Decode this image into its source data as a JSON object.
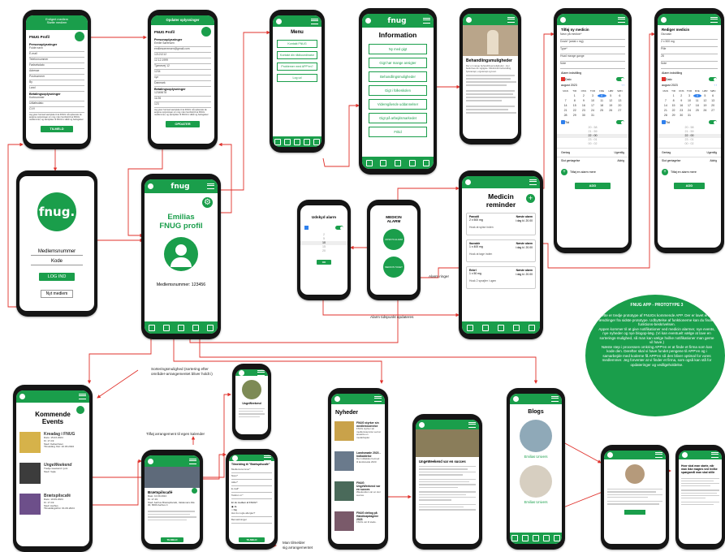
{
  "tilmeld_phone": {
    "header": [
      "Erdigert medlem",
      "Støtte medlem"
    ],
    "title": "FNUG Profil",
    "personal_section": "Personoplysninger",
    "fields": [
      "Fulde navn",
      "E-mail",
      "Telefonnummer",
      "Fødselsdato",
      "Adresse",
      "Postnummer",
      "By",
      "Land"
    ],
    "payment_section": "Betalingsoplysninger",
    "payment_fields": [
      "Kortnummer",
      "Udløbsdato",
      "CVV"
    ],
    "consent": "Jeg giver hermed samtykke til at FNUG må opbevare de angivne oplysninger om mig i den henhold til at FNUG medlemmer, og samtykker til FNUG's vilkår og betingelser",
    "button": "TILMELD"
  },
  "opdater_phone": {
    "header": "Opdater oplysninger",
    "title": "FNUG Profil",
    "personal_section": "Personoplysninger",
    "values": [
      "Emilie Sørensen",
      "emiliesoerensen@gmail.com",
      "12121212",
      "12.12.1999",
      "Tjørnevej 12",
      "1234",
      "xyz",
      "Danmark"
    ],
    "payment_section": "Betalingsoplysninger",
    "payment_values": [
      "12345678",
      "11/26",
      "123"
    ],
    "consent": "Jeg giver hermed samtykke til at FNUG må opbevare de angivne oplysninger om mig i den henhold til at FNUG medlemmer, og samtykker til FNUG's vilkår og betingelser",
    "button": "OPDATER"
  },
  "menu_phone": {
    "title": "Menu",
    "items": [
      "Kontakt FNUG",
      "Kontakt din rådkoordinator",
      "Problemer med APP'en?",
      "Log ud"
    ]
  },
  "info_phone": {
    "logo": "fnug",
    "title": "Information",
    "items": [
      "Ny med gigt",
      "Gigt hør mange ansigter",
      "Behandlingsmuligheder",
      "Gigt i folkeskolen",
      "Videregående uddannelser",
      "Gigt på arbejdsmarkedet",
      "Fritid"
    ]
  },
  "behandling_phone": {
    "title": "Behandlingsmuligheder",
    "body": "Der er mange behandlingsmuligheder - Her beskrives de vigtigste. Medicinsk behandling, fysioterapi, ergoterapi og kost."
  },
  "tilfoj_medicin_phone": {
    "title": "Tilføj ny medicin",
    "fields": [
      "Navn på medicin*",
      "Dosis* (antal x mg)",
      "Type*",
      "Hvad mange gange",
      "Note"
    ],
    "reminder_label": "Alarm indstilling",
    "start_label": "Dato",
    "month": "august 2023",
    "weekdays": [
      "MAN",
      "TIR",
      "ONS",
      "TOR",
      "FRE",
      "LØR",
      "SØN"
    ],
    "days": [
      "",
      "1",
      "2",
      "3",
      "4",
      "5",
      "6",
      "7",
      "8",
      "9",
      "10",
      "11",
      "12",
      "13",
      "14",
      "15",
      "16",
      "17",
      "18",
      "19",
      "20",
      "21",
      "22",
      "23",
      "24",
      "25",
      "26",
      "27",
      "28",
      "29",
      "30",
      "31"
    ],
    "selected_day": "4",
    "time_label": "Tid",
    "time_values": [
      "20 : 58",
      "21 : 59",
      "22 : 00",
      "23 : 01",
      "00 : 02"
    ],
    "repeat_label": "Gentag",
    "repeat_value": "Ugentlig",
    "ring_label": "Slut gentagelse",
    "ring_value": "Aldrig",
    "add_alarm": "Tilføj en alarm mere",
    "button": "ADD"
  },
  "rediger_medicin_phone": {
    "title": "Rediger medicin",
    "fields": [
      "Gluvasin",
      "2 x 500 mg",
      "Pille",
      "28",
      "Note"
    ],
    "reminder_label": "Alarm indstilling",
    "start_label": "Dato",
    "month": "august 2023",
    "weekdays": [
      "MAN",
      "TIR",
      "ONS",
      "TOR",
      "FRE",
      "LØR",
      "SØN"
    ],
    "days": [
      "",
      "1",
      "2",
      "3",
      "4",
      "5",
      "6",
      "7",
      "8",
      "9",
      "10",
      "11",
      "12",
      "13",
      "14",
      "15",
      "16",
      "17",
      "18",
      "19",
      "20",
      "21",
      "22",
      "23",
      "24",
      "25",
      "26",
      "27",
      "28",
      "29",
      "30",
      "31"
    ],
    "selected_day": "4",
    "time_label": "Tid",
    "time_values": [
      "20 : 58",
      "21 : 59",
      "22 : 00",
      "23 : 01",
      "00 : 02"
    ],
    "repeat_label": "Gentag",
    "repeat_value": "Ugentlig",
    "ring_label": "Slut gentagelse",
    "ring_value": "Aldrig",
    "add_alarm": "Tilføj en alarm mere",
    "button": "ADD"
  },
  "login_phone": {
    "logo": "fnug.",
    "member_field": "Medlemsnummer",
    "code_field": "Kode",
    "login_button": "LOG IND",
    "new_member": "Nyt medlem"
  },
  "profile_phone": {
    "logo": "fnug",
    "title_line1": "Emilias",
    "title_line2": "FNUG profil",
    "member_number": "Medlemsnummer: 123456"
  },
  "medicin_phone": {
    "title_line1": "Medicin",
    "title_line2": "reminder",
    "cards": [
      {
        "name": "Panodil",
        "dose": "2 x 500 mg",
        "note": "Husk at spise inden",
        "next_label": "Næste alarm",
        "next": "i dag kl. 20.00"
      },
      {
        "name": "Ibuvabir",
        "dose": "1 x 400 mg",
        "note": "Husk at tage inden",
        "next_label": "Næste alarm",
        "next": "i dag kl. 20.00"
      },
      {
        "name": "Enbrl",
        "dose": "1 x 50 mg",
        "note": "Husk 2 sprøjter i ugen",
        "next_label": "Næste alarm",
        "next": "i dag kl. 20.00"
      }
    ]
  },
  "udskyd_phone": {
    "title": "Udskyd alarm",
    "time_values": [
      "2",
      "5",
      "10",
      "15",
      "20"
    ],
    "button": "OK"
  },
  "alarm_phone": {
    "title_line1": "MEDICIN",
    "title_line2": "ALARM",
    "snooze": "UDSKYD ALARM",
    "taken": "MEDICIN TAGET"
  },
  "events_phone": {
    "title_line1": "Kommende",
    "title_line2": "Events",
    "events": [
      {
        "title": "Kreadag i FNUG",
        "lines": [
          "Dato: 15.03.2024",
          "Kl. 17-19",
          "Sted: København",
          "Tilmelding frist: 10.03.2024"
        ]
      },
      {
        "title": "UngeWeekend",
        "lines": [
          "Tredje weekend i juni",
          "Sted: Vejle"
        ]
      },
      {
        "title": "Brætspilscafé",
        "lines": [
          "Dato: 10.09.2024",
          "Kl. 17-19",
          "Sted: Aarhus",
          "Tilmeldingsfrist: 01.09.2024"
        ]
      }
    ]
  },
  "cafe_phone": {
    "title": "Brætspilscafé",
    "lines": [
      "Dato: 10.09.2024",
      "Kl. 17-19",
      "Sted: Aarhus Brætspilscafé, Valdemars Allé 30, 8000 Aarhus C"
    ],
    "button": "TILMELD"
  },
  "ungeweekend_phone": {
    "title": "UngeWeekend"
  },
  "form_phone": {
    "title": "Tilmelding til \"Brætspilscafé\"",
    "fields": [
      "Medlemsnummer*",
      "Navn*",
      "Alder*",
      "E-mail*",
      "Telefon nr.*",
      "Er du medlem af FNUG?",
      "Har du nogle allergier?",
      "Bemærkninger"
    ],
    "options": [
      "Ja",
      "Nej"
    ],
    "button": "TILMELD"
  },
  "nyheder_phone": {
    "title": "Nyheder",
    "items": [
      {
        "title": "FNUG styrker sin medlemsservice",
        "lines": [
          "FNUG styrker sin medlemsservice ved at ansætte en medarbejder."
        ]
      },
      {
        "title": "Landsmøde 2023 - Indkaldelse",
        "lines": [
          "Der indkaldes hermed til landsmøde 2023."
        ]
      },
      {
        "title": "FNUG UngeWeekend var en succes",
        "lines": [
          "Weekenden var en stor succes."
        ]
      },
      {
        "title": "FNUG deltog på Handicapdagene 2023",
        "lines": [
          "FNUG var til stede."
        ]
      }
    ]
  },
  "article_phone": {
    "title": "UngeWeekend var en succes"
  },
  "blogs_phone": {
    "title": "Blogs",
    "bloggers": [
      "Emilias Univers",
      "Emilias Univers"
    ]
  },
  "blogpost_phone": {
    "title": "Hvor skal man starte, når man ikke magtes ved hvilke spørgsmål man skal stille"
  },
  "annotations": {
    "sort_note": "Sorteringsmulighed (sortering efter områder-arrangementet bliver holdt i)",
    "calendar_note": "Tilføj arrangement til egen kalender",
    "alarm_note": "Alarm ringer",
    "alarm_update": "Alarm tidspunkt opdateres",
    "confirm_note_line1": "Man tilmelder",
    "confirm_note_line2": "sig arrangementet"
  },
  "description_box": {
    "title": "FNUG APP - PROTOTYPE 3",
    "paragraphs": [
      "Dette er tredje prototype af FNUGs kommende APP. Der er lavet en del ændringer fra sidste prototype. Udbyttelse af funktionerne kan du finde i funktions-beskrivelsen.",
      "Appen kommer til at give notifikationer ved medicin alarmer, nye events, nye nyheder og nye blogop-læg. (Vi kan eventuelt vælge at lave en sorterings-mulighed, så man kan vælge hvilke notifikationer man gerne vil have.)",
      "Næste step i processen omkring APP'en er at finde et firma som kan kode den. Derefter skal vi have fundet pengene til APP'en og i samarbejde med koderne få APP'en så den bliver optimal for vores medlemmer. Jeg forventer at vi finder et firma, som også kan stå for opdateringer og vedligeholdelse."
    ]
  },
  "colors": {
    "brand": "#1a9e4b",
    "arrow": "#e0312b"
  }
}
